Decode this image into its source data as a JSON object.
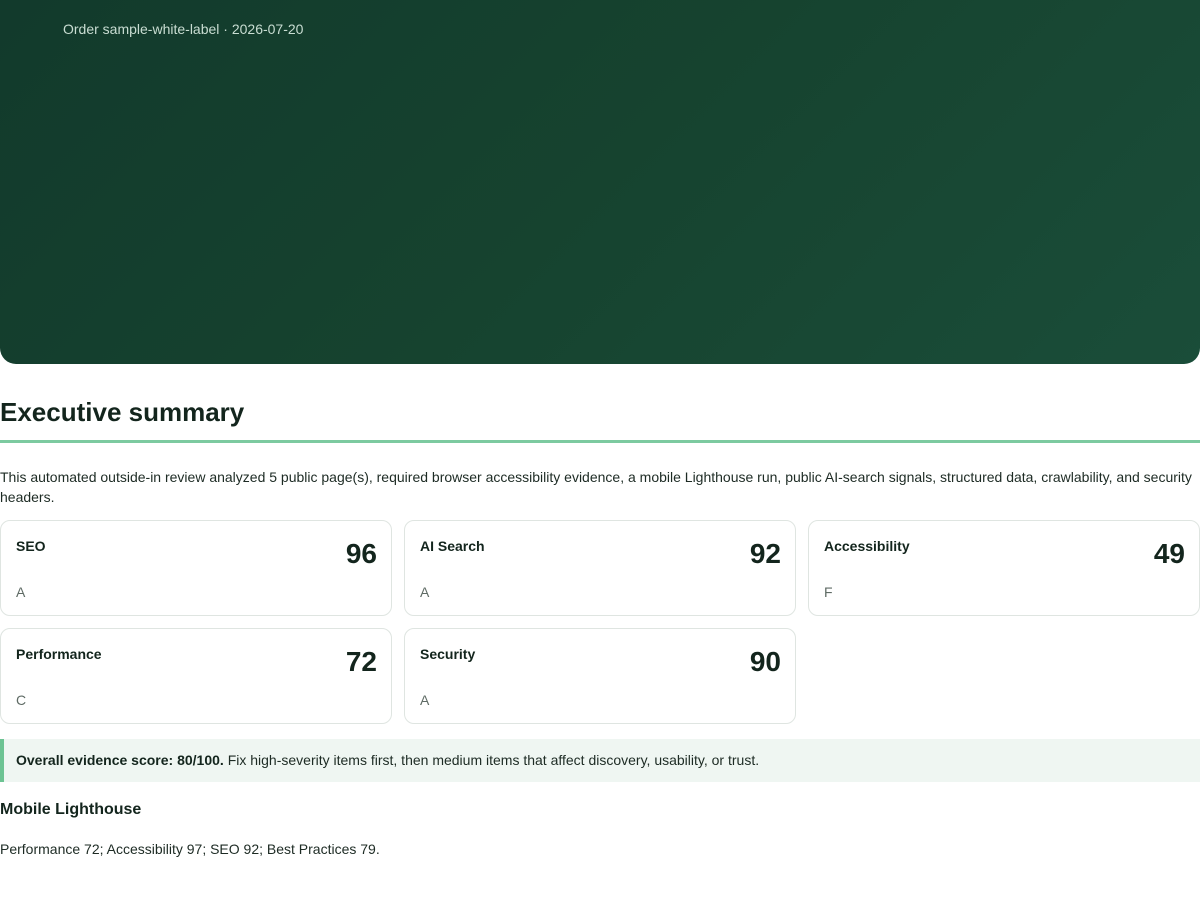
{
  "hero": {
    "meta": "Order sample-white-label · 2026-07-20"
  },
  "executive_summary": {
    "title": "Executive summary",
    "intro": "This automated outside-in review analyzed 5 public page(s), required browser accessibility evidence, a mobile Lighthouse run, public AI-search signals, structured data, crawlability, and security headers.",
    "cards": [
      {
        "label": "SEO",
        "score": "96",
        "grade": "A"
      },
      {
        "label": "AI Search",
        "score": "92",
        "grade": "A"
      },
      {
        "label": "Accessibility",
        "score": "49",
        "grade": "F"
      },
      {
        "label": "Performance",
        "score": "72",
        "grade": "C"
      },
      {
        "label": "Security",
        "score": "90",
        "grade": "A"
      }
    ],
    "callout": {
      "strong": "Overall evidence score: 80/100.",
      "text": " Fix high-severity items first, then medium items that affect discovery, usability, or trust."
    }
  },
  "mobile_lighthouse": {
    "title": "Mobile Lighthouse",
    "text": "Performance 72; Accessibility 97; SEO 92; Best Practices 79."
  }
}
